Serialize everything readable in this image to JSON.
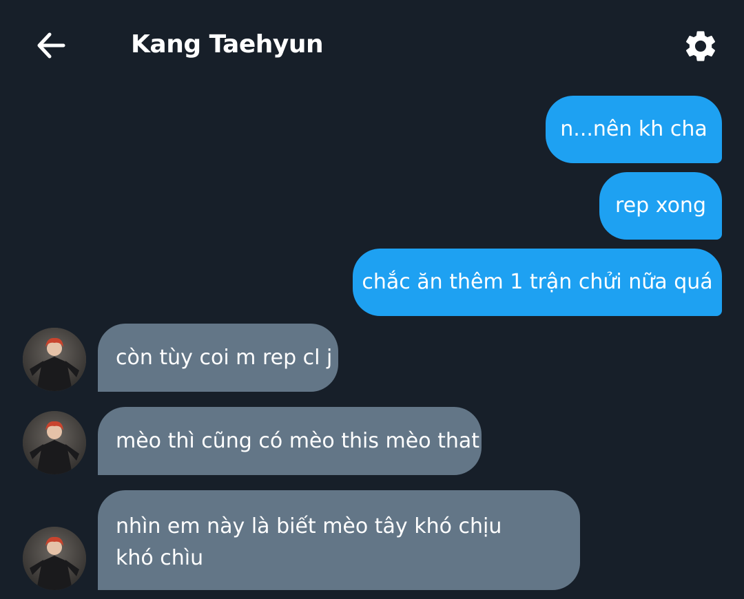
{
  "header": {
    "title": "Kang Taehyun",
    "back_icon": "arrow-left-icon",
    "settings_icon": "gear-icon"
  },
  "messages": [
    {
      "side": "outgoing",
      "text": "n...nên kh cha"
    },
    {
      "side": "outgoing",
      "text": "rep xong"
    },
    {
      "side": "outgoing",
      "text": "chắc ăn thêm 1 trận chửi nữa quá"
    },
    {
      "side": "incoming",
      "text": "còn tùy coi m rep cl j"
    },
    {
      "side": "incoming",
      "text": "mèo thì cũng có mèo this mèo that"
    },
    {
      "side": "incoming",
      "text": "nhìn em này là biết mèo tây khó chịu khó chìu"
    }
  ],
  "colors": {
    "background": "#171f29",
    "outgoing_bubble": "#1ea1f2",
    "incoming_bubble": "#637687",
    "text": "#ffffff"
  }
}
